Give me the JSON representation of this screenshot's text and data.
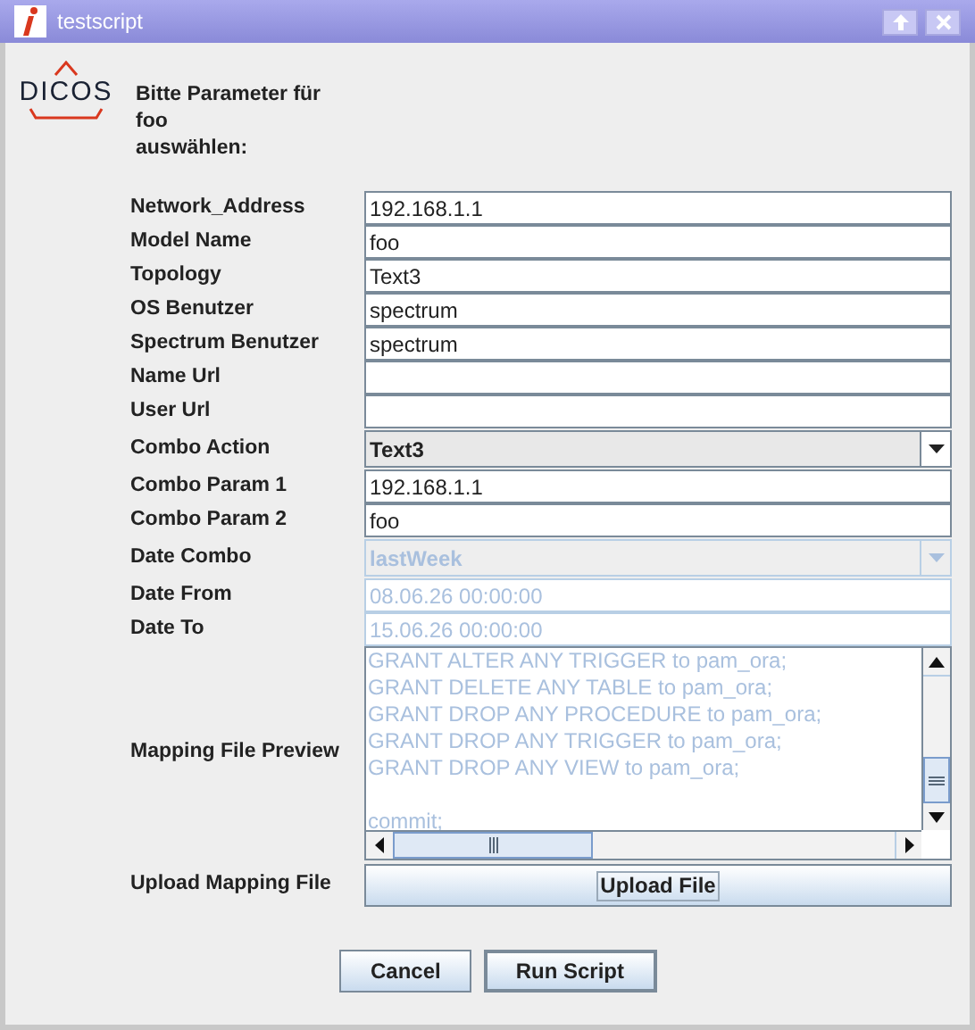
{
  "window": {
    "title": "testscript"
  },
  "logo": {
    "text": "DICOS"
  },
  "prompt": [
    "Bitte Parameter für",
    "foo",
    "auswählen:"
  ],
  "fields": [
    {
      "label": "Network_Address",
      "kind": "text",
      "value": "192.168.1.1",
      "disabled": false
    },
    {
      "label": "Model Name",
      "kind": "text",
      "value": "foo",
      "disabled": false
    },
    {
      "label": "Topology",
      "kind": "text",
      "value": "Text3",
      "disabled": false
    },
    {
      "label": "OS Benutzer",
      "kind": "text",
      "value": "spectrum",
      "disabled": false
    },
    {
      "label": "Spectrum Benutzer",
      "kind": "text",
      "value": "spectrum",
      "disabled": false
    },
    {
      "label": "Name Url",
      "kind": "text",
      "disabled": false
    },
    {
      "label": "User Url",
      "kind": "text",
      "disabled": false
    },
    {
      "label": "Combo Action",
      "kind": "combo",
      "value": "Text3",
      "disabled": false
    },
    {
      "label": "Combo Param 1",
      "kind": "text",
      "value": "192.168.1.1",
      "disabled": false
    },
    {
      "label": "Combo Param 2",
      "kind": "text",
      "value": "foo",
      "disabled": false
    },
    {
      "label": "Date Combo",
      "kind": "combo",
      "value": "lastWeek",
      "disabled": true
    },
    {
      "label": "Date From",
      "kind": "text",
      "value": "08.06.26 00:00:00",
      "disabled": true
    },
    {
      "label": "Date To",
      "kind": "text",
      "value": "15.06.26 00:00:00",
      "disabled": true
    },
    {
      "label": "Mapping File Preview",
      "kind": "textarea",
      "lines": [
        "GRANT ALTER ANY TRIGGER to pam_ora;",
        "GRANT DELETE ANY TABLE to pam_ora;",
        "GRANT DROP ANY PROCEDURE to pam_ora;",
        "GRANT DROP ANY TRIGGER to pam_ora;",
        "GRANT DROP ANY VIEW to pam_ora;"
      ],
      "after_blank_line": "commit;",
      "disabled": true
    },
    {
      "label": "Upload Mapping File",
      "kind": "button",
      "value": "Upload File",
      "disabled": false
    }
  ],
  "buttons": [
    "Cancel",
    "Run Script"
  ]
}
